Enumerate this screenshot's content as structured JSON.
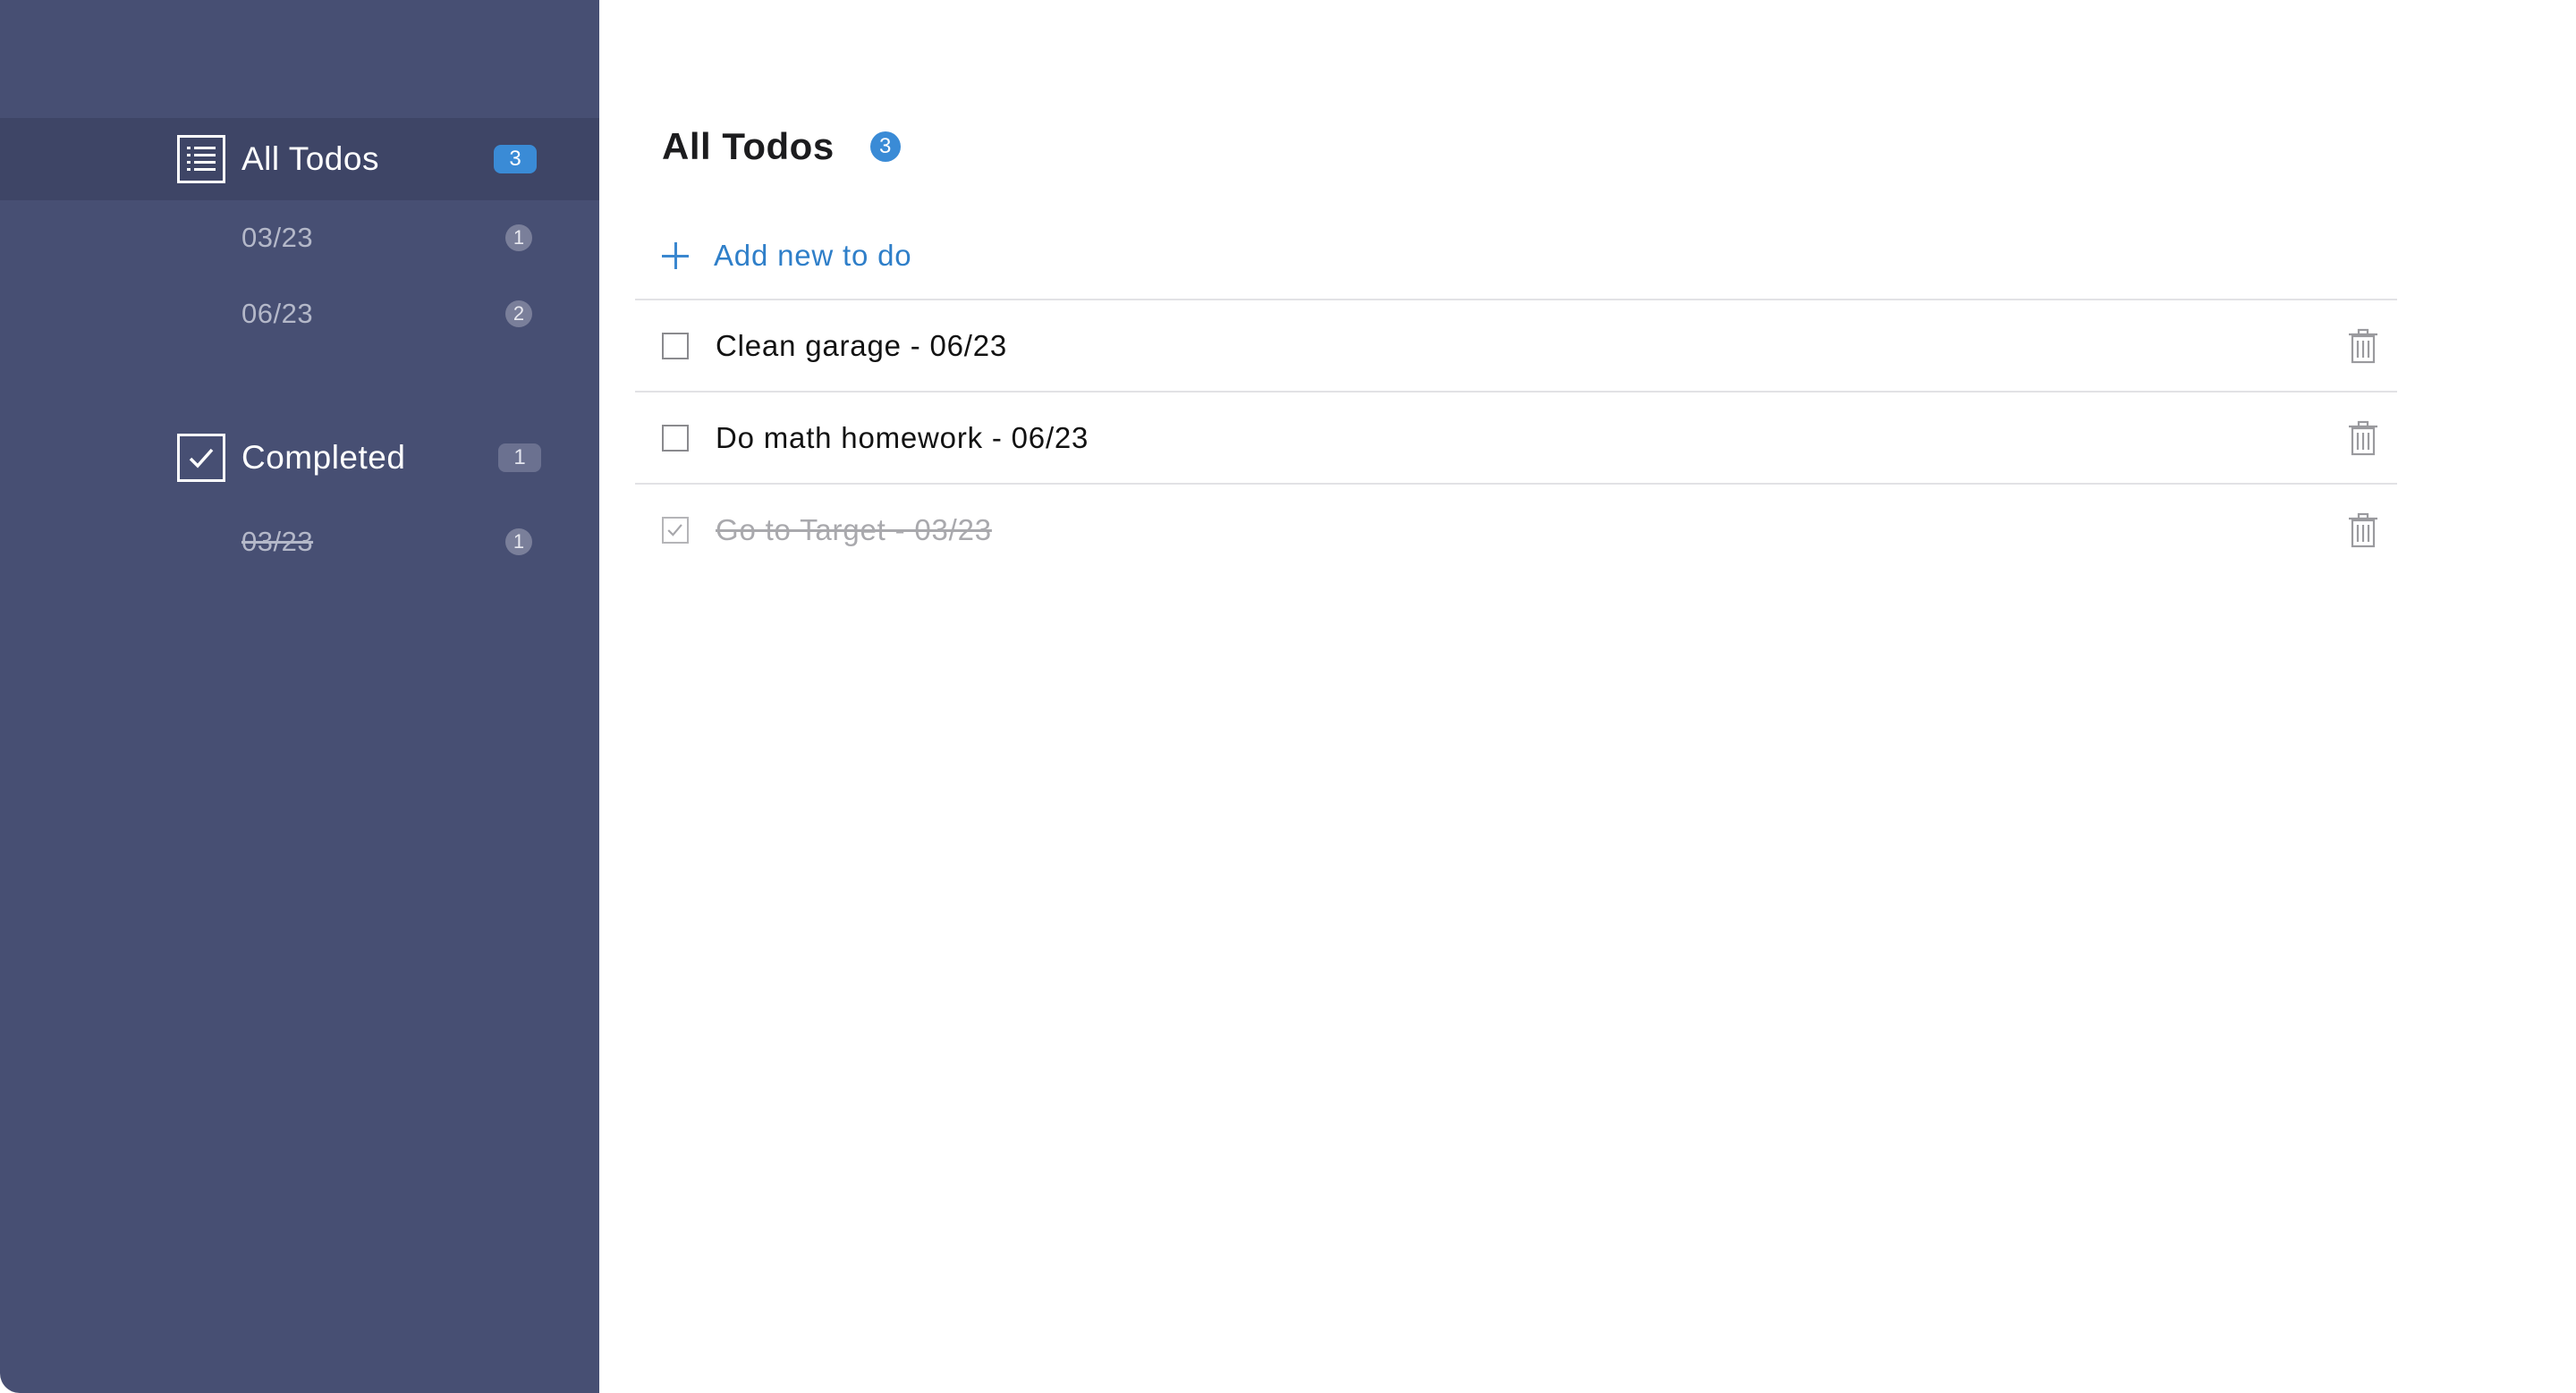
{
  "sidebar": {
    "all_todos": {
      "label": "All Todos",
      "count": "3",
      "icon": "list-icon"
    },
    "all_subitems": [
      {
        "label": "03/23",
        "count": "1"
      },
      {
        "label": "06/23",
        "count": "2"
      }
    ],
    "completed": {
      "label": "Completed",
      "count": "1",
      "icon": "checkbox-icon"
    },
    "completed_subitems": [
      {
        "label": "03/23",
        "count": "1"
      }
    ]
  },
  "main": {
    "title": "All Todos",
    "title_count": "3",
    "add_label": "Add new to do",
    "todos": [
      {
        "text": "Clean garage - 06/23",
        "done": false
      },
      {
        "text": "Do math homework - 06/23",
        "done": false
      },
      {
        "text": "Go to Target - 03/23",
        "done": true
      }
    ]
  },
  "colors": {
    "sidebar_bg": "#474f73",
    "sidebar_active": "#3e4566",
    "accent": "#3a8bd6"
  }
}
